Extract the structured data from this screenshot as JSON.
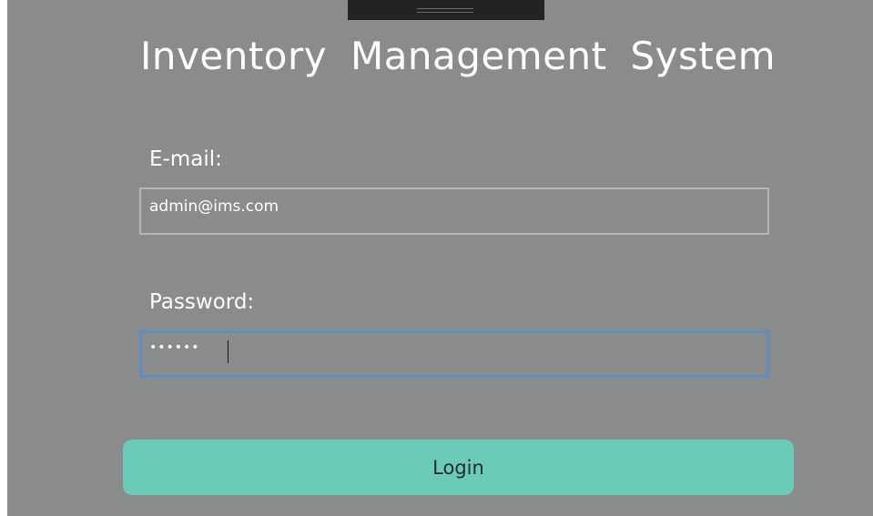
{
  "app": {
    "title": "Inventory  Management  System"
  },
  "form": {
    "email": {
      "label": "E-mail:",
      "value": "admin@ims.com"
    },
    "password": {
      "label": "Password:",
      "masked_value": "••••••"
    },
    "login_label": "Login"
  },
  "colors": {
    "window_background": "#8a8c8c",
    "focus_border": "#5b8fc4",
    "button_background": "#6acbb8"
  }
}
